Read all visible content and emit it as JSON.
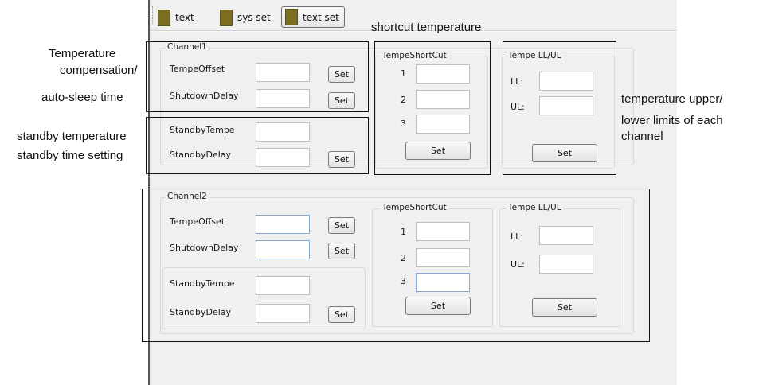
{
  "toolbar": {
    "items": [
      {
        "label": "text",
        "active": false
      },
      {
        "label": "sys set",
        "active": false
      },
      {
        "label": "text set",
        "active": true
      }
    ]
  },
  "annotations": {
    "shortcut": "shortcut temperature",
    "temp_comp_1": "Temperature",
    "temp_comp_2": "compensation/",
    "auto_sleep": "auto-sleep time",
    "standby_temp": "standby temperature",
    "standby_time": "standby time setting",
    "limits_1": "temperature upper/",
    "limits_2": "lower limits of each",
    "limits_3": "channel"
  },
  "channel1": {
    "title": "Channel1",
    "tempe_offset": "TempeOffset",
    "shutdown_delay": "ShutdownDelay",
    "standby_tempe": "StandbyTempe",
    "standby_delay": "StandbyDelay",
    "shortcut_title": "TempeShortCut",
    "shortcut_labels": [
      "1",
      "2",
      "3"
    ],
    "limits_title": "Tempe LL/UL",
    "ll_label": "LL:",
    "ul_label": "UL:",
    "set_label": "Set"
  },
  "channel2": {
    "title": "Channel2",
    "tempe_offset": "TempeOffset",
    "shutdown_delay": "ShutdownDelay",
    "standby_tempe": "StandbyTempe",
    "standby_delay": "StandbyDelay",
    "shortcut_title": "TempeShortCut",
    "shortcut_labels": [
      "1",
      "2",
      "3"
    ],
    "limits_title": "Tempe LL/UL",
    "ll_label": "LL:",
    "ul_label": "UL:",
    "set_label": "Set"
  },
  "colors": {
    "toolbar_icon": "#7a6e20",
    "panel_bg": "#f0f0f0",
    "highlight_border": "#111111"
  }
}
